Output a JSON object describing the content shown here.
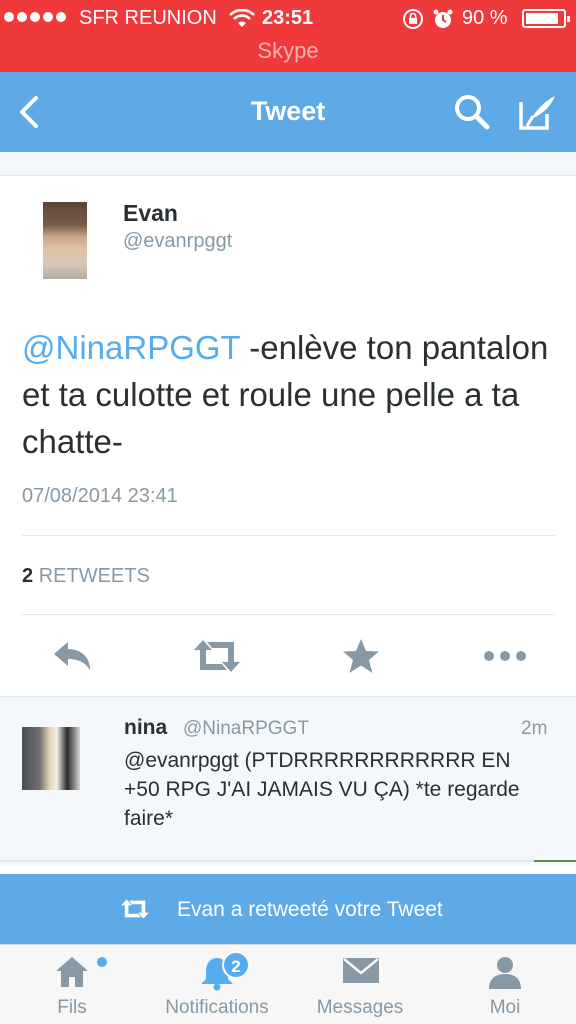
{
  "status_bar": {
    "carrier": "SFR REUNION",
    "time": "23:51",
    "battery": "90 %",
    "battery_level": 0.9,
    "app_label": "Skype",
    "icons": [
      "signal-dots-icon",
      "wifi-icon",
      "rotation-lock-icon",
      "alarm-icon",
      "battery-icon"
    ]
  },
  "nav": {
    "title": "Tweet",
    "icons": [
      "back-chevron-icon",
      "search-icon",
      "compose-icon"
    ]
  },
  "tweet": {
    "author_name": "Evan",
    "author_handle": "@evanrpggt",
    "mention": "@NinaRPGGT",
    "body": " -enlève ton pantalon et ta culotte et roule une pelle a ta chatte-",
    "date": "07/08/2014 23:41",
    "retweet_count": "2",
    "retweet_label": "RETWEETS",
    "actions": [
      "reply-icon",
      "retweet-icon",
      "favorite-icon",
      "more-icon"
    ]
  },
  "reply": {
    "name": "nina",
    "handle": "@NinaRPGGT",
    "time": "2m",
    "text": "@evanrpggt (PTDRRRRRRRRRRRR EN +50 RPG J'AI JAMAIS VU ÇA) *te regarde faire*"
  },
  "banner": {
    "text": "Evan a retweeté votre Tweet",
    "icon": "retweet-icon"
  },
  "tabs": [
    {
      "label": "Fils",
      "icon": "home-icon"
    },
    {
      "label": "Notifications",
      "icon": "bell-icon",
      "badge": "2"
    },
    {
      "label": "Messages",
      "icon": "envelope-icon"
    },
    {
      "label": "Moi",
      "icon": "person-icon"
    }
  ],
  "colors": {
    "status_bar": "#f0393a",
    "twitter_blue": "#5daae7",
    "link": "#55acee",
    "muted": "#8899a6",
    "text": "#292f33"
  }
}
